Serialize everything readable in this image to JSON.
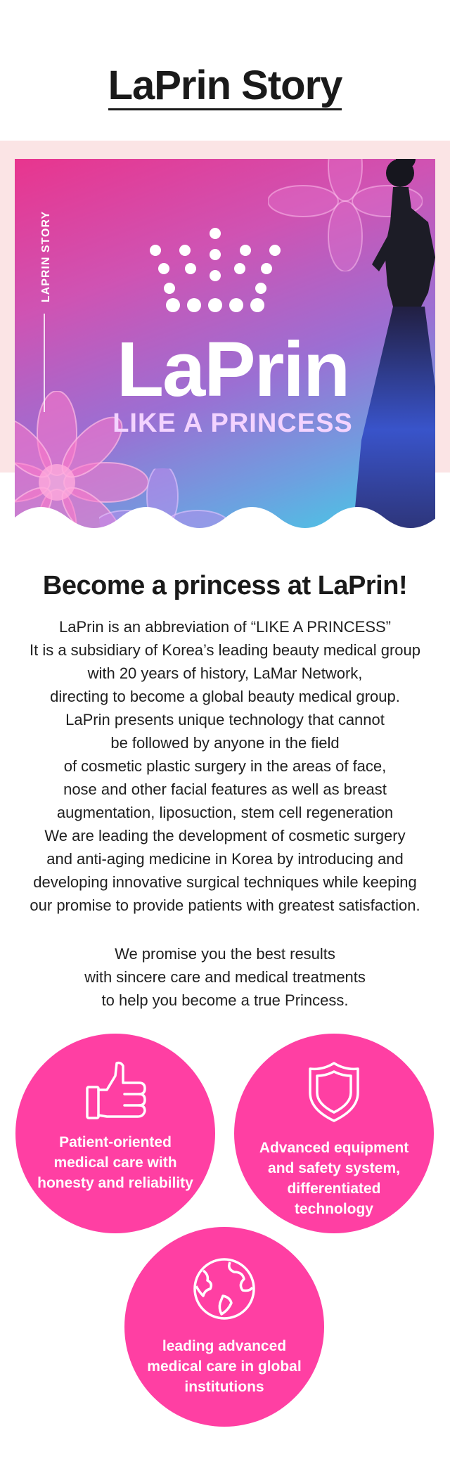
{
  "title": "LaPrin Story",
  "hero": {
    "side_label": "LAPRIN STORY",
    "brand": "LaPrin",
    "tagline": "LIKE A PRINCESS"
  },
  "heading": "Become a princess at LaPrin!",
  "paragraph": [
    "LaPrin is an abbreviation of “LIKE A PRINCESS”",
    "It is a subsidiary of Korea’s leading beauty medical group",
    "with 20 years of history, LaMar Network,",
    "directing to become a global beauty medical group.",
    "LaPrin presents unique technology that cannot",
    "be followed by anyone in the field",
    "of cosmetic plastic surgery in the areas of face,",
    "nose and other facial features as well as breast",
    "augmentation, liposuction, stem cell regeneration",
    "We are leading the development of cosmetic surgery",
    "and anti-aging medicine in Korea by introducing and",
    "developing innovative surgical techniques while keeping",
    "our promise to provide patients with greatest satisfaction."
  ],
  "promise": [
    "We promise you the best results",
    "with sincere care and medical treatments",
    "to help you become a true Princess."
  ],
  "features": [
    {
      "icon": "thumbs-up-icon",
      "label": "Patient-oriented medical care with honesty and reliability"
    },
    {
      "icon": "shield-icon",
      "label": "Advanced equipment and safety system, differentiated technology"
    },
    {
      "icon": "globe-icon",
      "label": "leading advanced medical care in global institutions"
    }
  ],
  "colors": {
    "accent": "#ff3fa3",
    "text": "#1a1a1a"
  }
}
